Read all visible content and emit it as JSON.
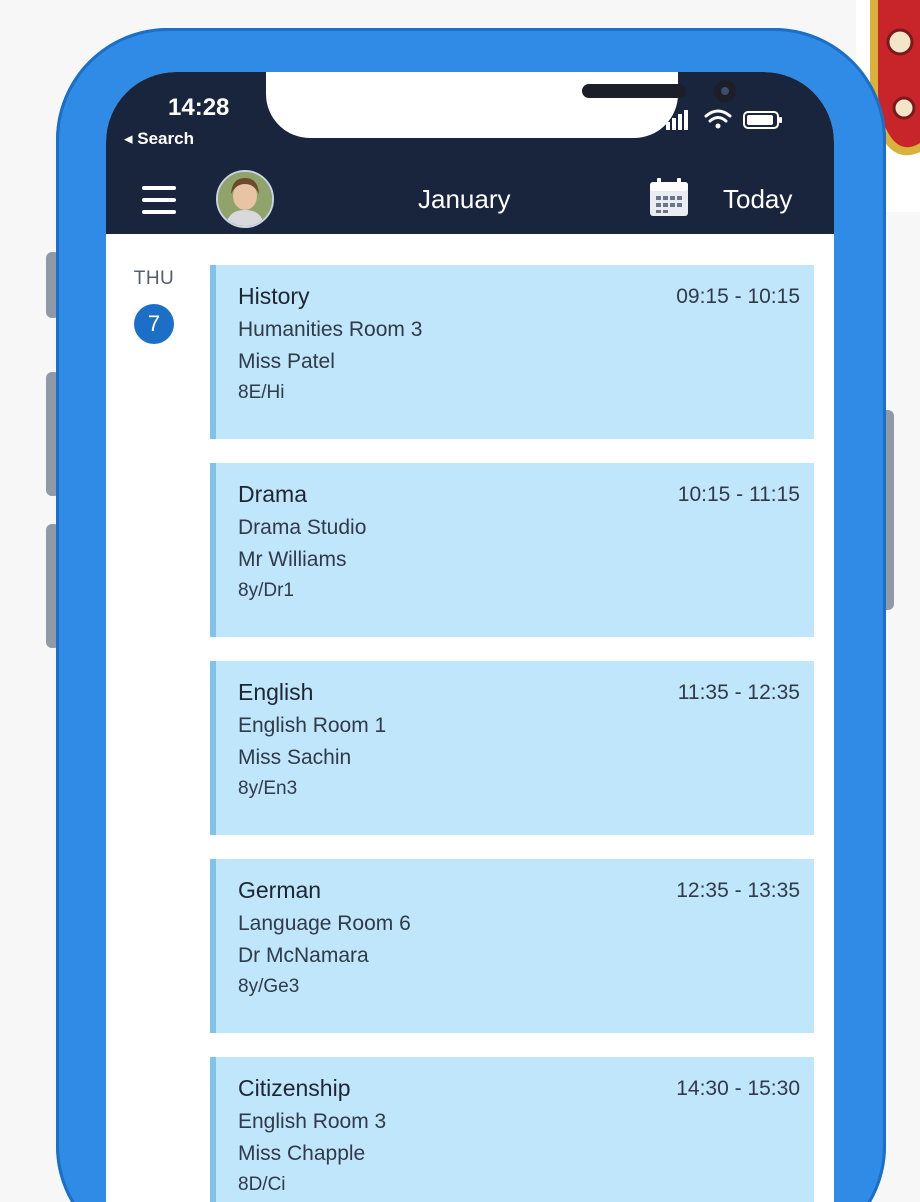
{
  "status_bar": {
    "time": "14:28",
    "back_label": "◂ Search"
  },
  "nav": {
    "month": "January",
    "today_label": "Today"
  },
  "day": {
    "weekday": "THU",
    "date": "7"
  },
  "colors": {
    "header": "#19243d",
    "phone_frame": "#2f8be6",
    "lesson_card": "#bfe6fb",
    "date_badge": "#1b6fc7"
  },
  "lessons": [
    {
      "subject": "History",
      "time": "09:15 - 10:15",
      "room": "Humanities Room 3",
      "teacher": "Miss Patel",
      "group": "8E/Hi"
    },
    {
      "subject": "Drama",
      "time": "10:15 - 11:15",
      "room": "Drama Studio",
      "teacher": "Mr Williams",
      "group": "8y/Dr1"
    },
    {
      "subject": "English",
      "time": "11:35 - 12:35",
      "room": "English Room 1",
      "teacher": "Miss Sachin",
      "group": "8y/En3"
    },
    {
      "subject": "German",
      "time": "12:35 - 13:35",
      "room": "Language Room 6",
      "teacher": "Dr McNamara",
      "group": "8y/Ge3"
    },
    {
      "subject": "Citizenship",
      "time": "14:30 - 15:30",
      "room": "English Room 3",
      "teacher": "Miss Chapple",
      "group": "8D/Ci"
    }
  ]
}
